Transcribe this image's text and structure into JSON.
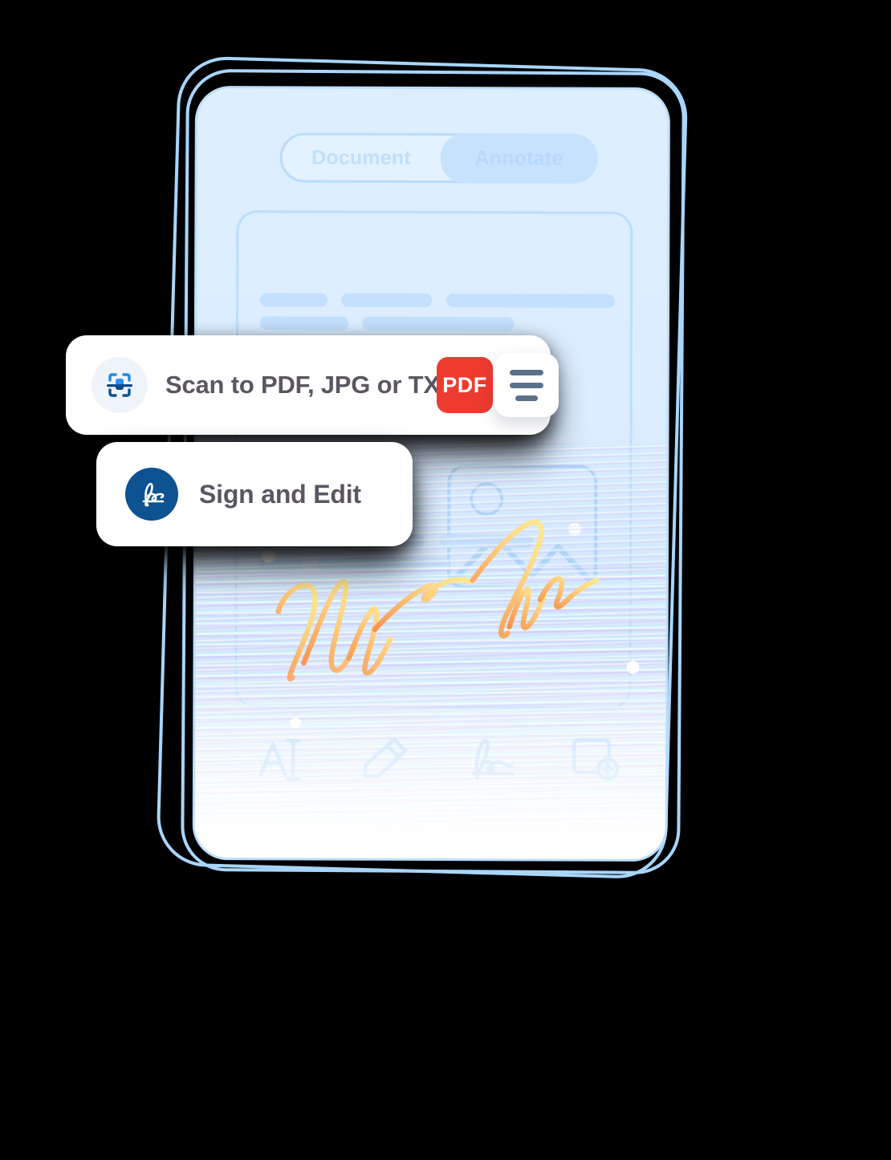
{
  "app": {
    "device": "phone-mockup",
    "screen_name": "pdf-annotate-screen"
  },
  "tabs": {
    "items": [
      {
        "label": "Document",
        "selected": false,
        "name": "tab-document"
      },
      {
        "label": "Annotate",
        "selected": true,
        "name": "tab-annotate"
      }
    ]
  },
  "document": {
    "placeholder_rows": [
      [
        120,
        160,
        310
      ],
      [
        115,
        195
      ]
    ],
    "placeholder_rows_lower": [
      [
        110,
        150,
        130
      ],
      [
        60,
        175
      ]
    ],
    "image_placeholder_icon": "image-placeholder-icon",
    "signature_overlay": "handwritten-signature"
  },
  "toolbar": {
    "items": [
      {
        "name": "text-tool-icon",
        "label": "Text"
      },
      {
        "name": "pencil-tool-icon",
        "label": "Draw"
      },
      {
        "name": "signature-tool-icon",
        "label": "Sign"
      },
      {
        "name": "add-page-icon",
        "label": "Add page"
      }
    ]
  },
  "cards": {
    "scan": {
      "label": "Scan to PDF, JPG or TXT",
      "icon": "document-scanner-icon",
      "badge_label": "PDF",
      "menu_icon": "hamburger-menu-icon"
    },
    "sign": {
      "label": "Sign and Edit",
      "icon": "signature-icon"
    }
  },
  "colors": {
    "accent_blue": "#1a73e8",
    "deep_blue": "#0d5291",
    "pdf_red": "#ee3b2f",
    "screen_bg": "#ddeeff",
    "outline_blue": "#a9d5fb",
    "bar_blue": "#c3e0fd",
    "label_gray": "#5b5661",
    "signature_start": "#ffe27a",
    "signature_end": "#f99455"
  }
}
